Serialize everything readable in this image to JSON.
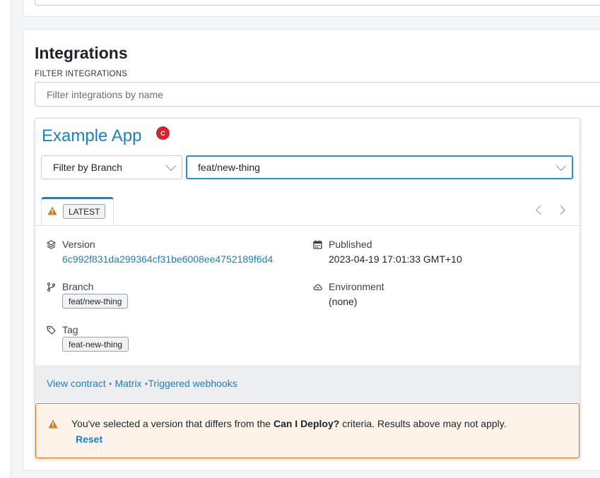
{
  "integrations": {
    "title": "Integrations",
    "filter_label": "FILTER INTEGRATIONS",
    "filter_placeholder": "Filter integrations by name",
    "filter_value": ""
  },
  "card": {
    "app_name": "Example App",
    "badge_letter": "C",
    "branch_filter_label": "Filter by Branch",
    "branch_value": "feat/new-thing",
    "tab_label": "LATEST",
    "fields": {
      "version_label": "Version",
      "version_value": "6c992f831da299364cf31be6008ee4752189f6d4",
      "published_label": "Published",
      "published_value": "2023-04-19 17:01:33 GMT+10",
      "branch_label": "Branch",
      "branch_value": "feat/new-thing",
      "environment_label": "Environment",
      "environment_value": "(none)",
      "tag_label": "Tag",
      "tag_value": "feat-new-thing"
    },
    "footer_links": {
      "view_contract": "View contract",
      "matrix": "Matrix",
      "triggered_webhooks": "Triggered webhooks",
      "separator": "•"
    },
    "alert": {
      "text_before": "You've selected a version that differs from the ",
      "text_bold": "Can I Deploy?",
      "text_after": " criteria. Results above may not apply.",
      "reset": "Reset"
    }
  },
  "colors": {
    "link": "#1b80c4",
    "badge": "#d4232b",
    "warning": "#d27a24",
    "alert_bg": "#fdf3e8",
    "focus_border": "#2a8fd6"
  }
}
